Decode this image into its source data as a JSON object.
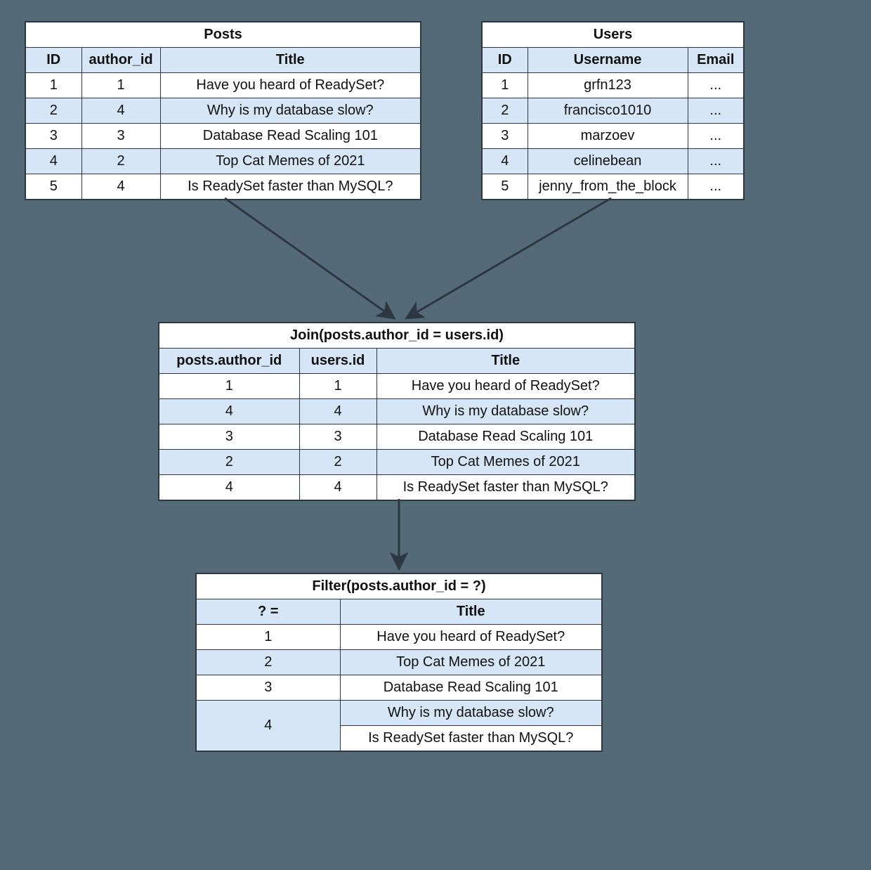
{
  "posts": {
    "title": "Posts",
    "headers": {
      "id": "ID",
      "author_id": "author_id",
      "title": "Title"
    },
    "rows": [
      {
        "id": "1",
        "author_id": "1",
        "title": "Have you heard of ReadySet?"
      },
      {
        "id": "2",
        "author_id": "4",
        "title": "Why is my database slow?"
      },
      {
        "id": "3",
        "author_id": "3",
        "title": "Database Read Scaling 101"
      },
      {
        "id": "4",
        "author_id": "2",
        "title": "Top Cat Memes of 2021"
      },
      {
        "id": "5",
        "author_id": "4",
        "title": "Is ReadySet faster than MySQL?"
      }
    ]
  },
  "users": {
    "title": "Users",
    "headers": {
      "id": "ID",
      "username": "Username",
      "email": "Email"
    },
    "rows": [
      {
        "id": "1",
        "username": "grfn123",
        "email": "..."
      },
      {
        "id": "2",
        "username": "francisco1010",
        "email": "..."
      },
      {
        "id": "3",
        "username": "marzoev",
        "email": "..."
      },
      {
        "id": "4",
        "username": "celinebean",
        "email": "..."
      },
      {
        "id": "5",
        "username": "jenny_from_the_block",
        "email": "..."
      }
    ]
  },
  "join": {
    "title": "Join(posts.author_id = users.id)",
    "headers": {
      "author_id": "posts.author_id",
      "users_id": "users.id",
      "title": "Title"
    },
    "rows": [
      {
        "author_id": "1",
        "users_id": "1",
        "title": "Have you heard of ReadySet?"
      },
      {
        "author_id": "4",
        "users_id": "4",
        "title": "Why is my database slow?"
      },
      {
        "author_id": "3",
        "users_id": "3",
        "title": "Database Read Scaling 101"
      },
      {
        "author_id": "2",
        "users_id": "2",
        "title": "Top Cat Memes of 2021"
      },
      {
        "author_id": "4",
        "users_id": "4",
        "title": "Is ReadySet faster than MySQL?"
      }
    ]
  },
  "filter": {
    "title": "Filter(posts.author_id = ?)",
    "headers": {
      "param": "? =",
      "title": "Title"
    },
    "groups": [
      {
        "param": "1",
        "titles": [
          "Have you heard of ReadySet?"
        ]
      },
      {
        "param": "2",
        "titles": [
          "Top Cat Memes of 2021"
        ]
      },
      {
        "param": "3",
        "titles": [
          "Database Read Scaling 101"
        ]
      },
      {
        "param": "4",
        "titles": [
          "Why is my database slow?",
          "Is ReadySet faster than MySQL?"
        ]
      }
    ]
  }
}
